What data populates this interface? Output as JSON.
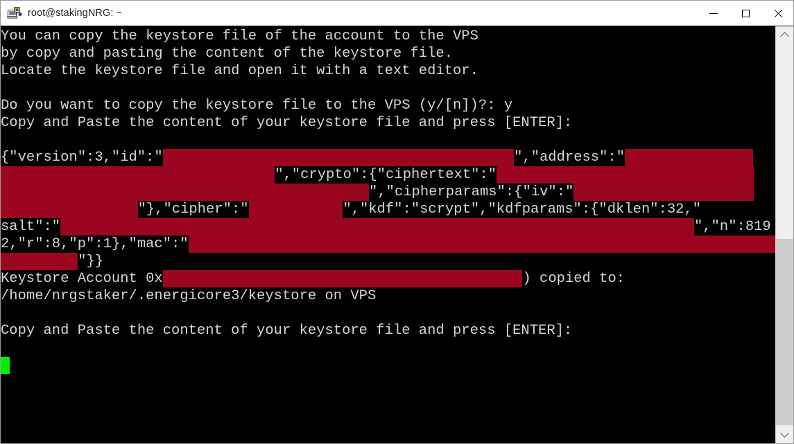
{
  "window": {
    "title": "root@stakingNRG: ~",
    "icon": "putty-terminal-icon",
    "controls": {
      "minimize_label": "—",
      "maximize_label": "□",
      "close_label": "✕"
    }
  },
  "terminal": {
    "background": "#000000",
    "foreground": "#d6d6d6",
    "redaction_color": "#9c0520",
    "cursor_color": "#00ef00",
    "lines": [
      {
        "id": "l01",
        "segments": [
          {
            "type": "text",
            "text": "You can copy the keystore file of the account to the VPS"
          }
        ]
      },
      {
        "id": "l02",
        "segments": [
          {
            "type": "text",
            "text": "by copy and pasting the content of the keystore file."
          }
        ]
      },
      {
        "id": "l03",
        "segments": [
          {
            "type": "text",
            "text": "Locate the keystore file and open it with a text editor."
          }
        ]
      },
      {
        "id": "l04",
        "segments": [
          {
            "type": "text",
            "text": ""
          }
        ]
      },
      {
        "id": "l05",
        "segments": [
          {
            "type": "text",
            "text": "Do you want to copy the keystore file to the VPS (y/[n])?: y"
          }
        ]
      },
      {
        "id": "l06",
        "segments": [
          {
            "type": "text",
            "text": "Copy and Paste the content of your keystore file and press [ENTER]:"
          }
        ]
      },
      {
        "id": "l07",
        "segments": [
          {
            "type": "text",
            "text": ""
          }
        ]
      },
      {
        "id": "l08",
        "segments": [
          {
            "type": "text",
            "text": "{\"version\":3,\"id\":\""
          },
          {
            "type": "redact",
            "chars": 41
          },
          {
            "type": "text",
            "text": "\",\"address\":\""
          },
          {
            "type": "redact",
            "chars": 15
          }
        ]
      },
      {
        "id": "l09",
        "segments": [
          {
            "type": "redact",
            "chars": 32
          },
          {
            "type": "text",
            "text": "\",\"crypto\":{\"ciphertext\":\""
          },
          {
            "type": "redact",
            "chars": 30
          }
        ]
      },
      {
        "id": "l10",
        "segments": [
          {
            "type": "redact",
            "chars": 43
          },
          {
            "type": "text",
            "text": "\",\"cipherparams\":{\"iv\":\""
          },
          {
            "type": "redact",
            "chars": 21
          }
        ]
      },
      {
        "id": "l11",
        "segments": [
          {
            "type": "redact",
            "chars": 16
          },
          {
            "type": "text",
            "text": "\"},\"cipher\":\""
          },
          {
            "type": "redact",
            "chars": 11
          },
          {
            "type": "text",
            "text": "\",\"kdf\":\"scrypt\",\"kdfparams\":{\"dklen\":32,\""
          }
        ]
      },
      {
        "id": "l12",
        "segments": [
          {
            "type": "text",
            "text": "salt\":\""
          },
          {
            "type": "redact",
            "chars": 74
          },
          {
            "type": "text",
            "text": "\",\"n\":819"
          }
        ]
      },
      {
        "id": "l13",
        "segments": [
          {
            "type": "text",
            "text": "2,\"r\":8,\"p\":1},\"mac\":\""
          },
          {
            "type": "redact",
            "chars": 70
          }
        ]
      },
      {
        "id": "l14",
        "segments": [
          {
            "type": "redact",
            "chars": 9
          },
          {
            "type": "text",
            "text": "\"}}"
          }
        ]
      },
      {
        "id": "l15",
        "segments": [
          {
            "type": "text",
            "text": "Keystore Account 0x"
          },
          {
            "type": "redact",
            "chars": 42
          },
          {
            "type": "text",
            "text": ") copied to:"
          }
        ]
      },
      {
        "id": "l16",
        "segments": [
          {
            "type": "text",
            "text": "/home/nrgstaker/.energicore3/keystore on VPS"
          }
        ]
      },
      {
        "id": "l17",
        "segments": [
          {
            "type": "text",
            "text": ""
          }
        ]
      },
      {
        "id": "l18",
        "segments": [
          {
            "type": "text",
            "text": "Copy and Paste the content of your keystore file and press [ENTER]:"
          }
        ]
      },
      {
        "id": "l19",
        "segments": [
          {
            "type": "text",
            "text": ""
          }
        ]
      },
      {
        "id": "l20",
        "segments": [
          {
            "type": "cursor"
          }
        ]
      }
    ]
  },
  "scrollbar": {
    "up_arrow": "chevron-up",
    "down_arrow": "chevron-down",
    "thumb_top_pct": 51,
    "thumb_height_pct": 49
  }
}
